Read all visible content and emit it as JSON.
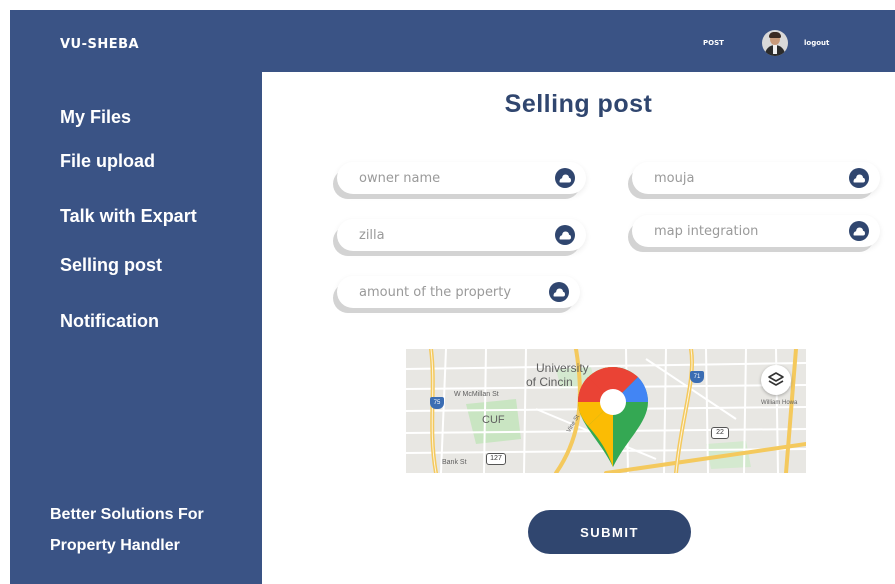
{
  "header": {
    "brand": "VU-SHEBA",
    "post_link": "POST",
    "logout_link": "logout"
  },
  "sidebar": {
    "items": [
      {
        "label": "My Files"
      },
      {
        "label": "File upload"
      },
      {
        "label": "Talk with Expart"
      },
      {
        "label": "Selling post"
      },
      {
        "label": "Notification"
      }
    ],
    "tagline_line1": "Better Solutions For",
    "tagline_line2": "Property Handler"
  },
  "main": {
    "title": "Selling post",
    "fields": {
      "owner_name": {
        "placeholder": "owner name",
        "value": ""
      },
      "mouja": {
        "placeholder": "mouja",
        "value": ""
      },
      "zilla": {
        "placeholder": "zilla",
        "value": ""
      },
      "map_integration": {
        "placeholder": "map integration",
        "value": ""
      },
      "amount": {
        "placeholder": "amount of the property",
        "value": ""
      }
    },
    "map": {
      "label_university_line1": "University",
      "label_university_line2": "of Cincin",
      "label_w_mcmillan": "W McMillan St",
      "label_cuf": "CUF",
      "label_bank_st": "Bank St",
      "label_william_howard": "William Howa",
      "label_vine_st": "Vine St",
      "shield_75": "75",
      "shield_71": "71",
      "shield_22": "22",
      "shield_127": "127"
    },
    "submit_label": "SUBMIT"
  },
  "colors": {
    "navy": "#3a5385",
    "title_navy": "#30466f",
    "field_icon": "#30466f"
  },
  "icons": {
    "field_icon": "cloud-icon",
    "map_pin": "google-maps-pin-icon",
    "map_layers": "layers-icon"
  }
}
